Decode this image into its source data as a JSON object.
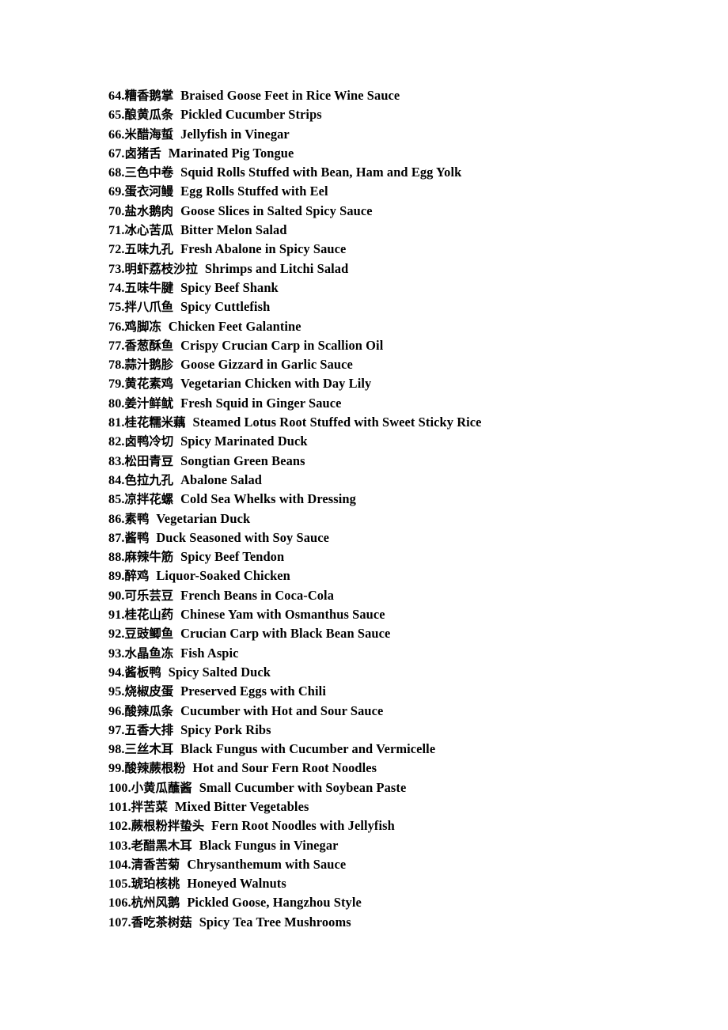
{
  "document": {
    "kind": "bilingual-menu-page",
    "background_color": "#ffffff",
    "text_color": "#000000",
    "separator": "  "
  },
  "menu": {
    "items": [
      {
        "number": "64.",
        "zh": "糟香鹅掌",
        "en": "Braised Goose Feet in Rice Wine Sauce"
      },
      {
        "number": "65.",
        "zh": "酿黄瓜条",
        "en": "Pickled Cucumber Strips"
      },
      {
        "number": "66.",
        "zh": "米醋海蜇",
        "en": "Jellyfish in Vinegar"
      },
      {
        "number": "67.",
        "zh": "卤猪舌",
        "en": "Marinated Pig Tongue"
      },
      {
        "number": "68.",
        "zh": "三色中卷",
        "en": "Squid Rolls Stuffed with Bean, Ham and Egg Yolk"
      },
      {
        "number": "69.",
        "zh": "蛋衣河鳗",
        "en": "Egg Rolls Stuffed with Eel"
      },
      {
        "number": "70.",
        "zh": "盐水鹅肉",
        "en": "Goose Slices in Salted Spicy Sauce"
      },
      {
        "number": "71.",
        "zh": "冰心苦瓜",
        "en": "Bitter Melon Salad"
      },
      {
        "number": "72.",
        "zh": "五味九孔",
        "en": "Fresh Abalone in Spicy Sauce"
      },
      {
        "number": "73.",
        "zh": "明虾荔枝沙拉",
        "en": "Shrimps and Litchi Salad"
      },
      {
        "number": "74.",
        "zh": "五味牛腱",
        "en": "Spicy Beef Shank"
      },
      {
        "number": "75.",
        "zh": "拌八爪鱼",
        "en": "Spicy Cuttlefish"
      },
      {
        "number": "76.",
        "zh": "鸡脚冻",
        "en": "Chicken Feet Galantine"
      },
      {
        "number": "77.",
        "zh": "香葱酥鱼",
        "en": "Crispy Crucian Carp in Scallion Oil"
      },
      {
        "number": "78.",
        "zh": "蒜汁鹅胗",
        "en": "Goose Gizzard in Garlic Sauce"
      },
      {
        "number": "79.",
        "zh": "黄花素鸡",
        "en": "Vegetarian Chicken with Day Lily"
      },
      {
        "number": "80.",
        "zh": "姜汁鲜鱿",
        "en": "Fresh Squid in Ginger Sauce"
      },
      {
        "number": "81.",
        "zh": "桂花糯米藕",
        "en": "Steamed Lotus Root Stuffed with Sweet Sticky Rice"
      },
      {
        "number": "82.",
        "zh": "卤鸭冷切",
        "en": "Spicy Marinated Duck"
      },
      {
        "number": "83.",
        "zh": "松田青豆",
        "en": "Songtian Green Beans"
      },
      {
        "number": "84.",
        "zh": "色拉九孔",
        "en": "Abalone Salad"
      },
      {
        "number": "85.",
        "zh": "凉拌花螺",
        "en": "Cold Sea Whelks with Dressing"
      },
      {
        "number": "86.",
        "zh": "素鸭",
        "en": "Vegetarian Duck"
      },
      {
        "number": "87.",
        "zh": "酱鸭",
        "en": "Duck Seasoned with Soy Sauce"
      },
      {
        "number": "88.",
        "zh": "麻辣牛筋",
        "en": "Spicy Beef Tendon"
      },
      {
        "number": "89.",
        "zh": "醉鸡",
        "en": "Liquor-Soaked Chicken"
      },
      {
        "number": "90.",
        "zh": "可乐芸豆",
        "en": "French Beans in Coca-Cola"
      },
      {
        "number": "91.",
        "zh": "桂花山药",
        "en": "Chinese Yam with Osmanthus Sauce"
      },
      {
        "number": "92.",
        "zh": "豆豉鲫鱼",
        "en": "Crucian Carp with Black Bean Sauce"
      },
      {
        "number": "93.",
        "zh": "水晶鱼冻",
        "en": "Fish Aspic"
      },
      {
        "number": "94.",
        "zh": "酱板鸭",
        "en": "Spicy Salted Duck"
      },
      {
        "number": "95.",
        "zh": "烧椒皮蛋",
        "en": "Preserved Eggs with Chili"
      },
      {
        "number": "96.",
        "zh": "酸辣瓜条",
        "en": "Cucumber with Hot and Sour Sauce"
      },
      {
        "number": "97.",
        "zh": "五香大排",
        "en": "Spicy Pork Ribs"
      },
      {
        "number": "98.",
        "zh": "三丝木耳",
        "en": "Black Fungus with Cucumber and Vermicelle"
      },
      {
        "number": "99.",
        "zh": "酸辣蕨根粉",
        "en": "Hot and Sour Fern Root Noodles"
      },
      {
        "number": "100.",
        "zh": "小黄瓜蘸酱",
        "en": "Small Cucumber with Soybean Paste"
      },
      {
        "number": "101.",
        "zh": "拌苦菜",
        "en": "Mixed Bitter Vegetables"
      },
      {
        "number": "102.",
        "zh": "蕨根粉拌蛰头",
        "en": "Fern Root Noodles with Jellyfish"
      },
      {
        "number": "103.",
        "zh": "老醋黑木耳",
        "en": "Black Fungus in Vinegar"
      },
      {
        "number": "104.",
        "zh": "清香苦菊",
        "en": "Chrysanthemum with Sauce"
      },
      {
        "number": "105.",
        "zh": "琥珀核桃",
        "en": "Honeyed Walnuts"
      },
      {
        "number": "106.",
        "zh": "杭州风鹅",
        "en": "Pickled Goose, Hangzhou Style"
      },
      {
        "number": "107.",
        "zh": "香吃茶树菇",
        "en": "Spicy Tea Tree Mushrooms"
      }
    ]
  }
}
